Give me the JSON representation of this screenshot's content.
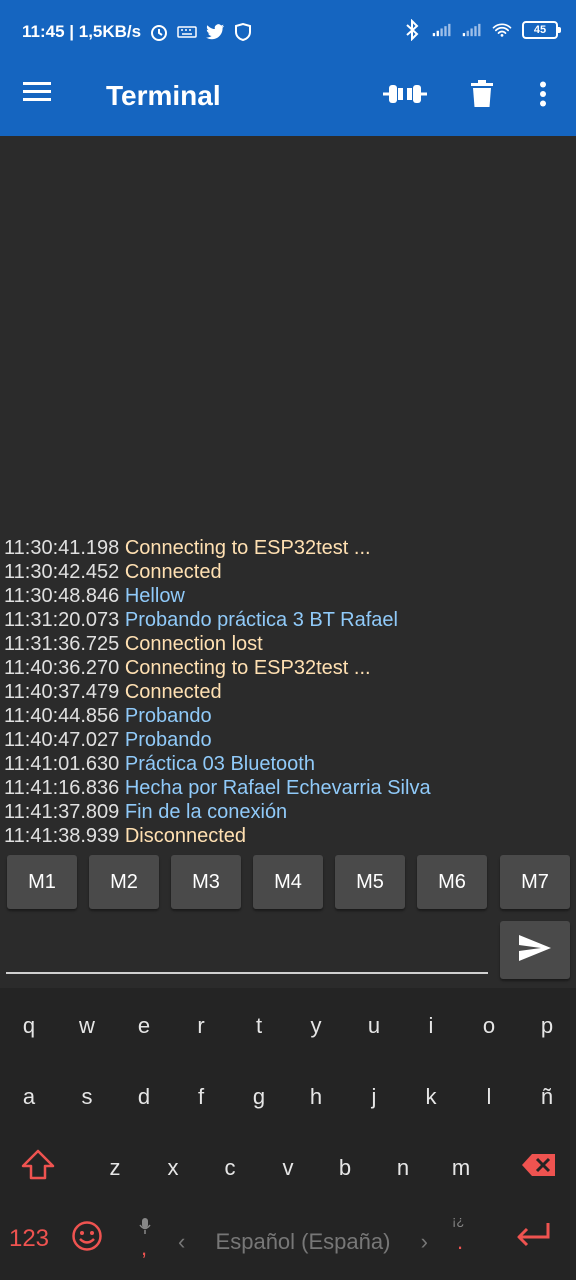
{
  "status_bar": {
    "time_speed": "11:45 | 1,5KB/s",
    "battery": "45"
  },
  "app_bar": {
    "title": "Terminal"
  },
  "terminal": {
    "lines": [
      {
        "ts": "11:30:41.198",
        "text": "Connecting to ESP32test ...",
        "kind": "status"
      },
      {
        "ts": "11:30:42.452",
        "text": "Connected",
        "kind": "status"
      },
      {
        "ts": "11:30:48.846",
        "text": "Hellow",
        "kind": "received"
      },
      {
        "ts": "11:31:20.073",
        "text": "Probando práctica 3 BT Rafael",
        "kind": "received"
      },
      {
        "ts": "11:31:36.725",
        "text": "Connection lost",
        "kind": "status"
      },
      {
        "ts": "11:40:36.270",
        "text": "Connecting to ESP32test ...",
        "kind": "status"
      },
      {
        "ts": "11:40:37.479",
        "text": "Connected",
        "kind": "status"
      },
      {
        "ts": "11:40:44.856",
        "text": "Probando",
        "kind": "received"
      },
      {
        "ts": "11:40:47.027",
        "text": "Probando",
        "kind": "received"
      },
      {
        "ts": "11:41:01.630",
        "text": "Práctica 03 Bluetooth",
        "kind": "received"
      },
      {
        "ts": "11:41:16.836",
        "text": "Hecha por Rafael Echevarria Silva",
        "kind": "received"
      },
      {
        "ts": "11:41:37.809",
        "text": "Fin de la conexión",
        "kind": "received"
      },
      {
        "ts": "11:41:38.939",
        "text": "Disconnected",
        "kind": "status"
      }
    ]
  },
  "macros": [
    "M1",
    "M2",
    "M3",
    "M4",
    "M5",
    "M6",
    "M7"
  ],
  "input": {
    "value": ""
  },
  "keyboard": {
    "row1": [
      "q",
      "w",
      "e",
      "r",
      "t",
      "y",
      "u",
      "i",
      "o",
      "p"
    ],
    "row2": [
      "a",
      "s",
      "d",
      "f",
      "g",
      "h",
      "j",
      "k",
      "l",
      "ñ"
    ],
    "row3": [
      "z",
      "x",
      "c",
      "v",
      "b",
      "n",
      "m"
    ],
    "numbers_key": "123",
    "comma": ",",
    "period": ".",
    "punct_hint": "¡¿",
    "language": "Español (España)",
    "lang_prev": "‹",
    "lang_next": "›"
  },
  "colors": {
    "app_bar": "#1565c0",
    "background": "#2b2b2b",
    "status_text": "#ffe0b2",
    "received_text": "#90caf9",
    "accent_red": "#ef5350"
  },
  "icons": {
    "menu": "hamburger-icon",
    "connect": "plug-icon",
    "clear": "trash-icon",
    "more": "more-vert-icon",
    "send": "send-icon"
  }
}
